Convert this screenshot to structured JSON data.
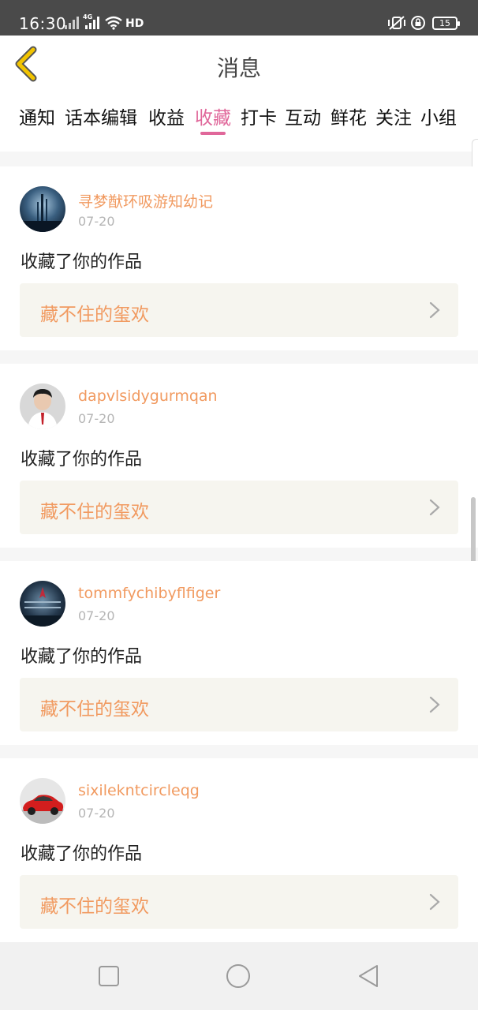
{
  "status_bar": {
    "time": "16:30",
    "network_1": "4G",
    "wifi_label": "HD",
    "battery": "15"
  },
  "header": {
    "title": "消息",
    "back_icon": "chevron-left-icon",
    "accent": "#f2c400"
  },
  "tabs": [
    {
      "label": "通知"
    },
    {
      "label": "话本编辑"
    },
    {
      "label": "收益"
    },
    {
      "label": "收藏",
      "active": true
    },
    {
      "label": "打卡"
    },
    {
      "label": "互动"
    },
    {
      "label": "鲜花"
    },
    {
      "label": "关注"
    },
    {
      "label": "小组"
    }
  ],
  "messages": [
    {
      "username": "寻梦猷环吸游知幼记",
      "date": "07-20",
      "action": "收藏了你的作品",
      "work_title": "藏不住的玺欢",
      "avatar": "city-night-avatar"
    },
    {
      "username": "dapvlsidygurmqan",
      "date": "07-20",
      "action": "收藏了你的作品",
      "work_title": "藏不住的玺欢",
      "avatar": "boy-portrait-avatar"
    },
    {
      "username": "tommfychibyflfiger",
      "date": "07-20",
      "action": "收藏了你的作品",
      "work_title": "藏不住的玺欢",
      "avatar": "night-scene-avatar"
    },
    {
      "username": "sixilekntcircleqg",
      "date": "07-20",
      "action": "收藏了你的作品",
      "work_title": "藏不住的玺欢",
      "avatar": "red-car-avatar"
    }
  ],
  "colors": {
    "active_tab": "#e0679a",
    "username": "#f19a60",
    "work_title": "#f19a60"
  },
  "nav_bar": {
    "icons": [
      "square-recent-icon",
      "circle-home-icon",
      "triangle-back-icon"
    ]
  }
}
